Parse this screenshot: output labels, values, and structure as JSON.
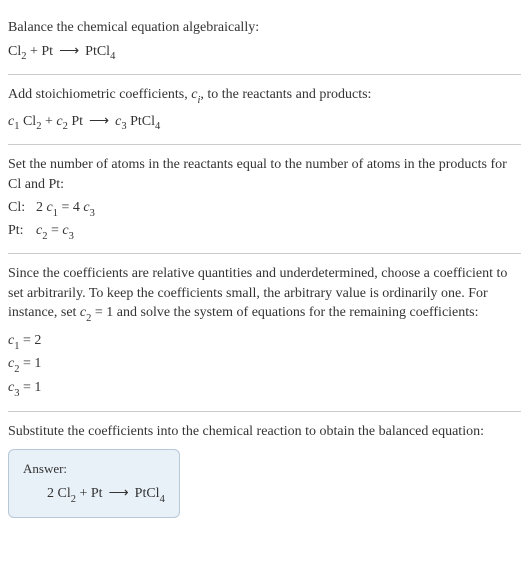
{
  "section1": {
    "instruction": "Balance the chemical equation algebraically:",
    "cl2": "Cl",
    "cl2_sub": "2",
    "plus": " + ",
    "pt": "Pt",
    "arrow": "⟶",
    "ptcl": "PtCl",
    "ptcl_sub": "4"
  },
  "section2": {
    "instruction_a": "Add stoichiometric coefficients, ",
    "ci": "c",
    "ci_sub": "i",
    "instruction_b": ", to the reactants and products:",
    "c1": "c",
    "c1_sub": "1",
    "sp": " ",
    "cl2": "Cl",
    "cl2_sub": "2",
    "plus": " + ",
    "c2": "c",
    "c2_sub": "2",
    "pt": "Pt",
    "arrow": "⟶",
    "c3": "c",
    "c3_sub": "3",
    "ptcl": "PtCl",
    "ptcl_sub": "4"
  },
  "section3": {
    "instruction": "Set the number of atoms in the reactants equal to the number of atoms in the products for Cl and Pt:",
    "row1_label": "Cl: ",
    "row1_a": "2 ",
    "row1_c1": "c",
    "row1_c1_sub": "1",
    "row1_eq": " = 4 ",
    "row1_c3": "c",
    "row1_c3_sub": "3",
    "row2_label": "Pt: ",
    "row2_c2": "c",
    "row2_c2_sub": "2",
    "row2_eq": " = ",
    "row2_c3": "c",
    "row2_c3_sub": "3"
  },
  "section4": {
    "instruction_a": "Since the coefficients are relative quantities and underdetermined, choose a coefficient to set arbitrarily. To keep the coefficients small, the arbitrary value is ordinarily one. For instance, set ",
    "c2": "c",
    "c2_sub": "2",
    "instruction_b": " = 1 and solve the system of equations for the remaining coefficients:",
    "r1_c": "c",
    "r1_sub": "1",
    "r1_val": " = 2",
    "r2_c": "c",
    "r2_sub": "2",
    "r2_val": " = 1",
    "r3_c": "c",
    "r3_sub": "3",
    "r3_val": " = 1"
  },
  "section5": {
    "instruction": "Substitute the coefficients into the chemical reaction to obtain the balanced equation:",
    "answer_label": "Answer:",
    "two": "2 ",
    "cl2": "Cl",
    "cl2_sub": "2",
    "plus": " + ",
    "pt": "Pt",
    "arrow": "⟶",
    "ptcl": "PtCl",
    "ptcl_sub": "4"
  }
}
